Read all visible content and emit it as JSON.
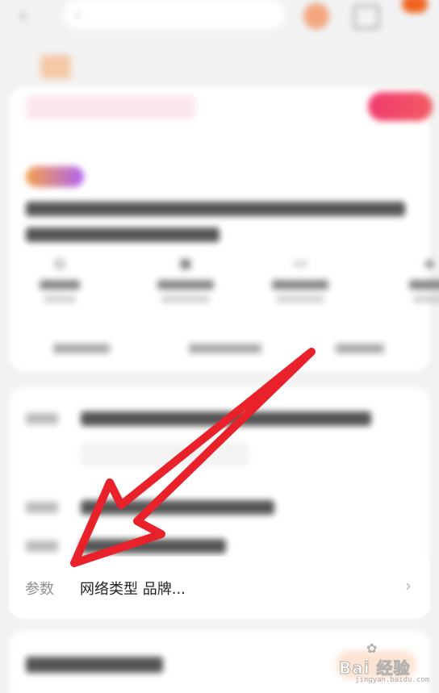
{
  "params_row": {
    "label": "参数",
    "value": "网络类型 品牌...",
    "chevron": "›"
  },
  "watermark": {
    "text": "Bai 经验",
    "sub": "jingyan.baidu.com"
  },
  "icons": {
    "back": "chevron-left-icon",
    "search": "search-icon",
    "share": "share-icon",
    "cart": "cart-icon",
    "arrow": "red-arrow-annotation"
  },
  "colors": {
    "arrow": "#e8212b",
    "accent": "#f0641e",
    "background": "#f2f2f2"
  }
}
